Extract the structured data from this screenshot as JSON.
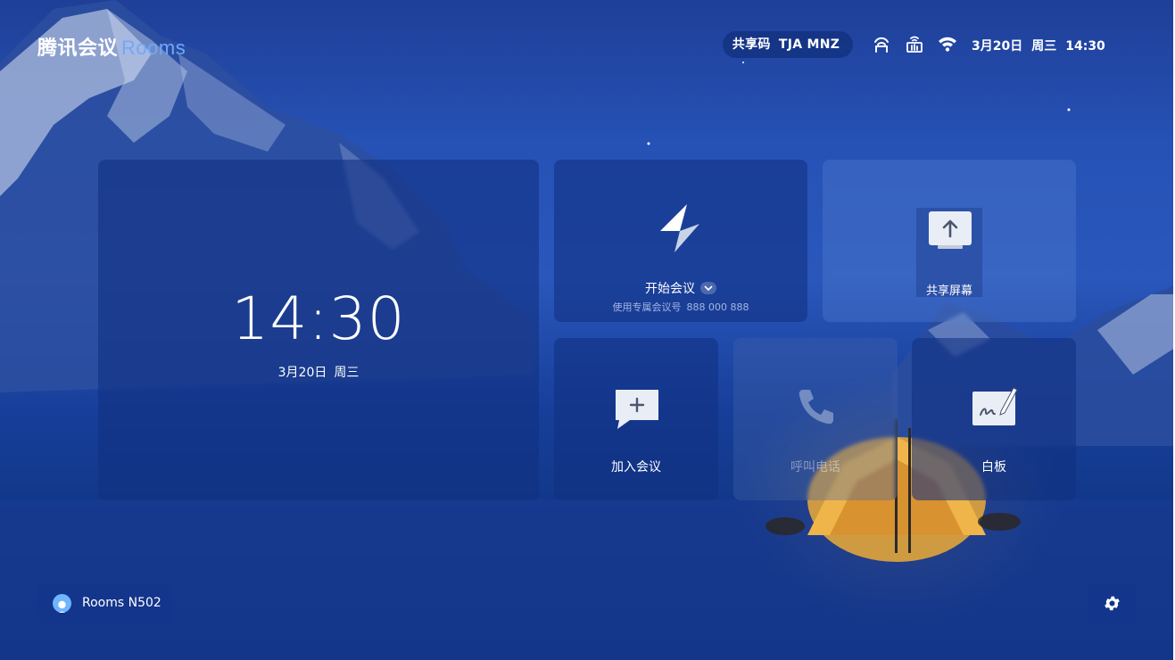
{
  "brand": {
    "name": "腾讯会议",
    "product": "Rooms"
  },
  "status_bar": {
    "share_code_label": "共享码",
    "share_code": "TJA MNZ",
    "icons": [
      "screen-cast-icon",
      "device-cast-icon",
      "wifi-icon"
    ],
    "date": "3月20日",
    "weekday": "周三",
    "time": "14:30"
  },
  "clock_card": {
    "time": "14:30",
    "date": "3月20日",
    "weekday": "周三"
  },
  "tiles": {
    "start_meeting": {
      "label": "开始会议",
      "sub_label": "使用专属会议号",
      "meeting_id": "888 000 888",
      "icon": "lightning-icon"
    },
    "share_screen": {
      "label": "共享屏幕",
      "icon": "share-screen-icon"
    },
    "join_meeting": {
      "label": "加入会议",
      "icon": "add-chat-icon"
    },
    "call": {
      "label": "呼叫电话",
      "icon": "phone-icon",
      "enabled": false
    },
    "whiteboard": {
      "label": "白板",
      "icon": "whiteboard-pen-icon"
    }
  },
  "room": {
    "name": "Rooms N502",
    "icon": "room-avatar-icon"
  },
  "settings": {
    "icon": "gear-icon"
  },
  "colors": {
    "accent": "#6fa8ff",
    "card_bg": "#123082",
    "background": "#1f4bae"
  }
}
